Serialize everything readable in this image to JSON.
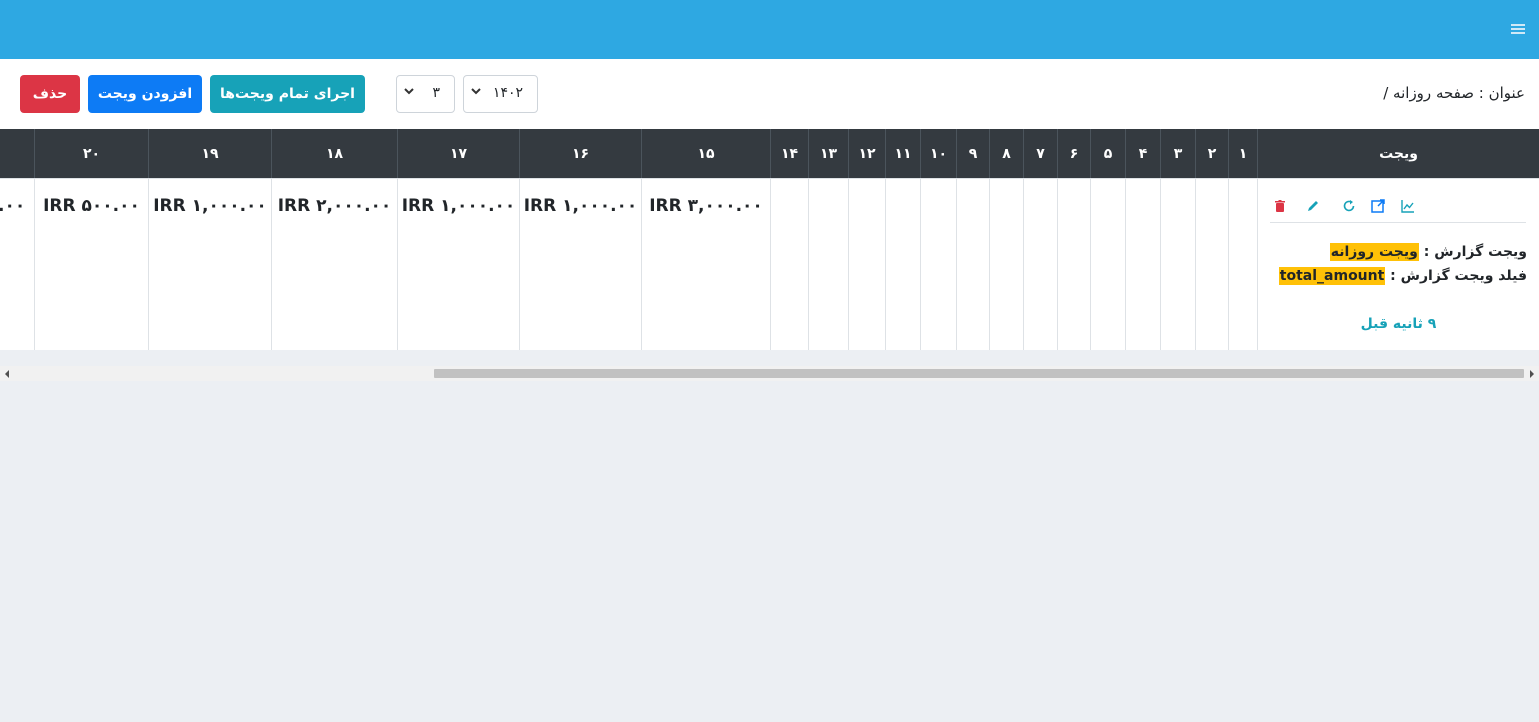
{
  "header": {
    "menu_icon": "hamburger-menu-icon",
    "bar_color": "#2ea8e2"
  },
  "toolbar": {
    "title": "عنوان : صفحه روزانه /",
    "year_select": {
      "value": "۱۴۰۲",
      "icon": "chevron-down-icon"
    },
    "month_select": {
      "value": "۳",
      "icon": "chevron-down-icon"
    },
    "run_all_label": "اجرای تمام ویجت‌ها",
    "add_widget_label": "افزودن ویجت",
    "delete_label": "حذف",
    "colors": {
      "run": "#17a2b8",
      "add": "#0d7bf5",
      "delete": "#dc3545"
    }
  },
  "table": {
    "widget_header": "ویجت",
    "day_headers": [
      "۱",
      "۲",
      "۳",
      "۴",
      "۵",
      "۶",
      "۷",
      "۸",
      "۹",
      "۱۰",
      "۱۱",
      "۱۲",
      "۱۳",
      "۱۴",
      "۱۵",
      "۱۶",
      "۱۷",
      "۱۸",
      "۱۹",
      "۲۰"
    ],
    "amounts": {
      "15": "IRR ۳,۰۰۰.۰۰",
      "16": "IRR ۱,۰۰۰.۰۰",
      "17": "IRR ۱,۰۰۰.۰۰",
      "18": "IRR ۲,۰۰۰.۰۰",
      "19": "IRR ۱,۰۰۰.۰۰",
      "20": "IRR ۵۰۰.۰۰",
      "partial": ".۰۰"
    },
    "widget": {
      "actions": [
        "chart-icon",
        "open-external-icon",
        "refresh-icon",
        "edit-icon",
        "delete-icon"
      ],
      "report_label": "ویجت گزارش : ",
      "report_value": "ویجت روزانه",
      "field_label": "فیلد ویجت گزارش : ",
      "field_value": "total_amount",
      "time_ago": "۹ ثانیه قبل",
      "highlight_color": "#ffc107"
    }
  }
}
